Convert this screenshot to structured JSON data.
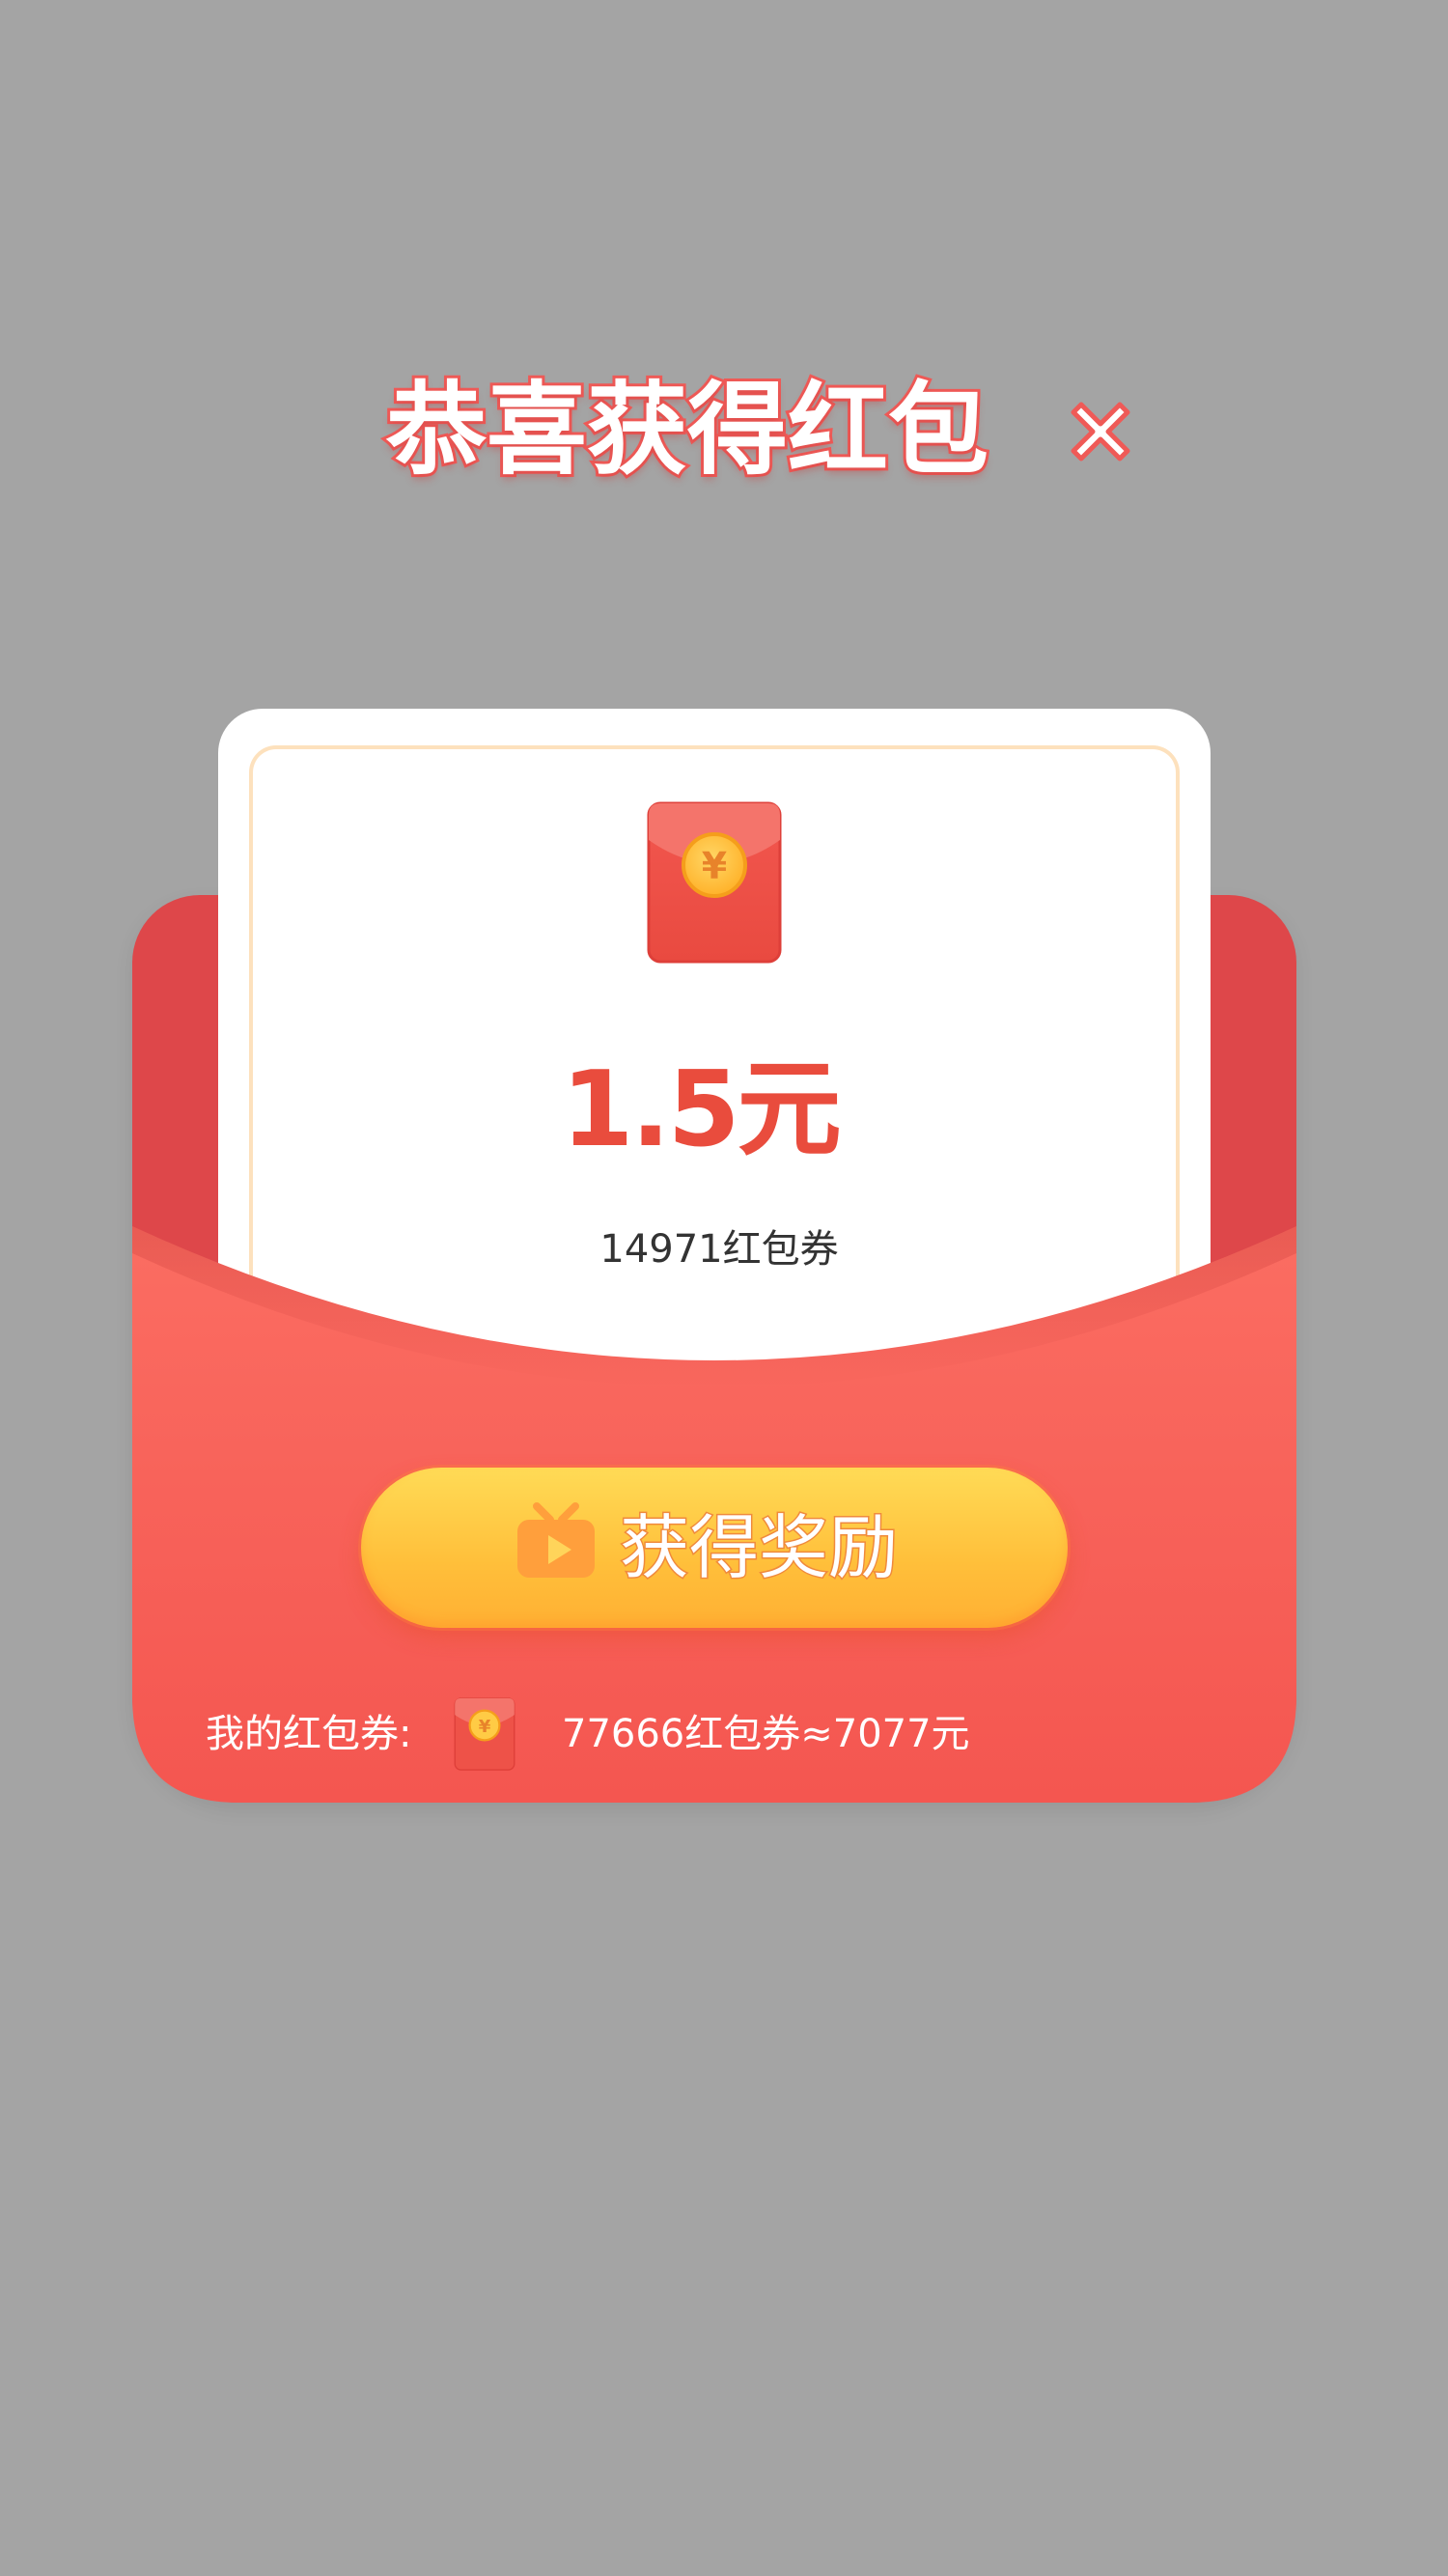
{
  "dialog": {
    "title": "恭喜获得红包",
    "close_icon": "close-icon"
  },
  "reward": {
    "amount": "1.5元",
    "coupons": "14971红包券",
    "packet_icon": "red-packet-icon"
  },
  "action": {
    "claim_label": "获得奖励",
    "claim_icon": "video-tv-icon"
  },
  "balance": {
    "label": "我的红包券:",
    "value": "77666红包券≈7077元",
    "icon": "red-packet-icon"
  },
  "colors": {
    "backdrop": "#a4a4a4",
    "envelope": "#f55a50",
    "accent_red": "#e94c3d",
    "button_gold": "#ffc43d"
  }
}
